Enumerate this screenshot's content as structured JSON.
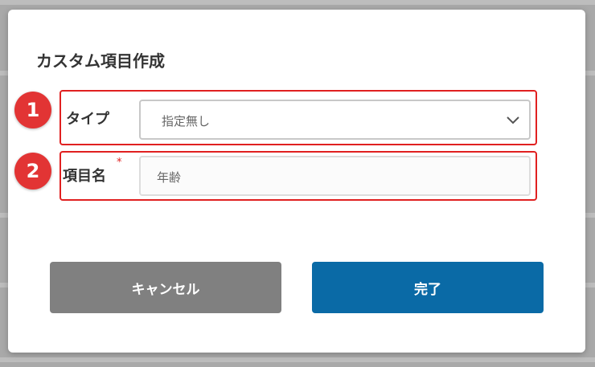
{
  "dialog": {
    "title": "カスタム項目作成"
  },
  "fields": {
    "type": {
      "badge": "1",
      "label": "タイプ",
      "value": "指定無し"
    },
    "name": {
      "badge": "2",
      "label": "項目名",
      "required_mark": "*",
      "value": "年齢"
    }
  },
  "buttons": {
    "cancel_label": "キャンセル",
    "done_label": "完了"
  },
  "colors": {
    "highlight": "#e02020",
    "badge": "#e23434",
    "cancel": "#808080",
    "primary": "#0a6aa6"
  },
  "icons": {
    "select_caret": "chevron-down-icon"
  }
}
